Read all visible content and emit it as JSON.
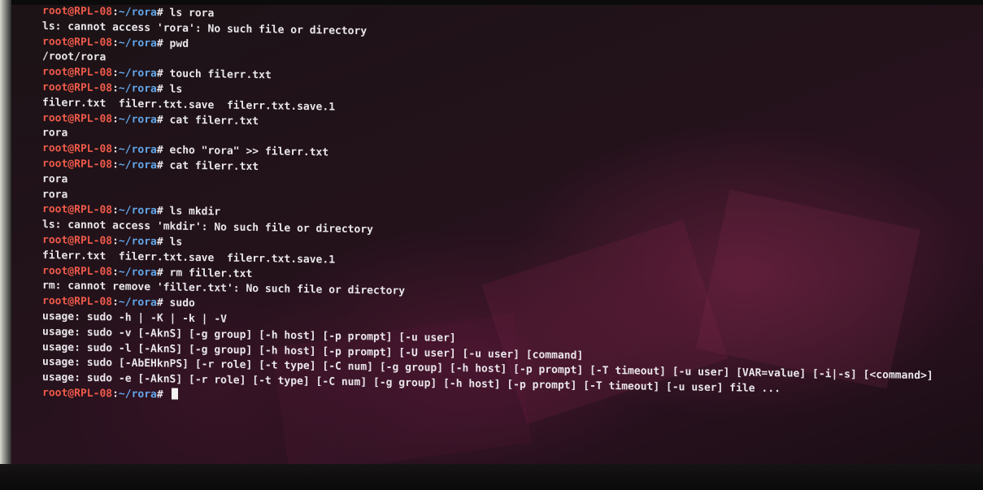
{
  "prompt": {
    "user_host": "root@RPL-08",
    "separator": ":",
    "path": "~/rora",
    "symbol": "#"
  },
  "lines": [
    {
      "type": "prompt",
      "cmd": " ls rora"
    },
    {
      "type": "output",
      "text": "ls: cannot access 'rora': No such file or directory"
    },
    {
      "type": "prompt",
      "cmd": " pwd"
    },
    {
      "type": "output",
      "text": "/root/rora"
    },
    {
      "type": "prompt",
      "cmd": " touch filerr.txt"
    },
    {
      "type": "prompt",
      "cmd": " ls"
    },
    {
      "type": "output",
      "text": "filerr.txt  filerr.txt.save  filerr.txt.save.1"
    },
    {
      "type": "prompt",
      "cmd": " cat filerr.txt"
    },
    {
      "type": "output",
      "text": "rora"
    },
    {
      "type": "prompt",
      "cmd": " echo \"rora\" >> filerr.txt"
    },
    {
      "type": "prompt",
      "cmd": " cat filerr.txt"
    },
    {
      "type": "output",
      "text": "rora"
    },
    {
      "type": "output",
      "text": "rora"
    },
    {
      "type": "prompt",
      "cmd": " ls mkdir"
    },
    {
      "type": "output",
      "text": "ls: cannot access 'mkdir': No such file or directory"
    },
    {
      "type": "prompt",
      "cmd": " ls"
    },
    {
      "type": "output",
      "text": "filerr.txt  filerr.txt.save  filerr.txt.save.1"
    },
    {
      "type": "prompt",
      "cmd": " rm filler.txt"
    },
    {
      "type": "output",
      "text": "rm: cannot remove 'filler.txt': No such file or directory"
    },
    {
      "type": "prompt",
      "cmd": " sudo"
    },
    {
      "type": "output",
      "text": "usage: sudo -h | -K | -k | -V"
    },
    {
      "type": "output",
      "text": "usage: sudo -v [-AknS] [-g group] [-h host] [-p prompt] [-u user]"
    },
    {
      "type": "output",
      "text": "usage: sudo -l [-AknS] [-g group] [-h host] [-p prompt] [-U user] [-u user] [command]"
    },
    {
      "type": "output",
      "text": "usage: sudo [-AbEHknPS] [-r role] [-t type] [-C num] [-g group] [-h host] [-p prompt] [-T timeout] [-u user] [VAR=value] [-i|-s] [<command>]"
    },
    {
      "type": "output",
      "text": "usage: sudo -e [-AknS] [-r role] [-t type] [-C num] [-g group] [-h host] [-p prompt] [-T timeout] [-u user] file ..."
    },
    {
      "type": "prompt",
      "cmd": " ",
      "cursor": true
    }
  ]
}
